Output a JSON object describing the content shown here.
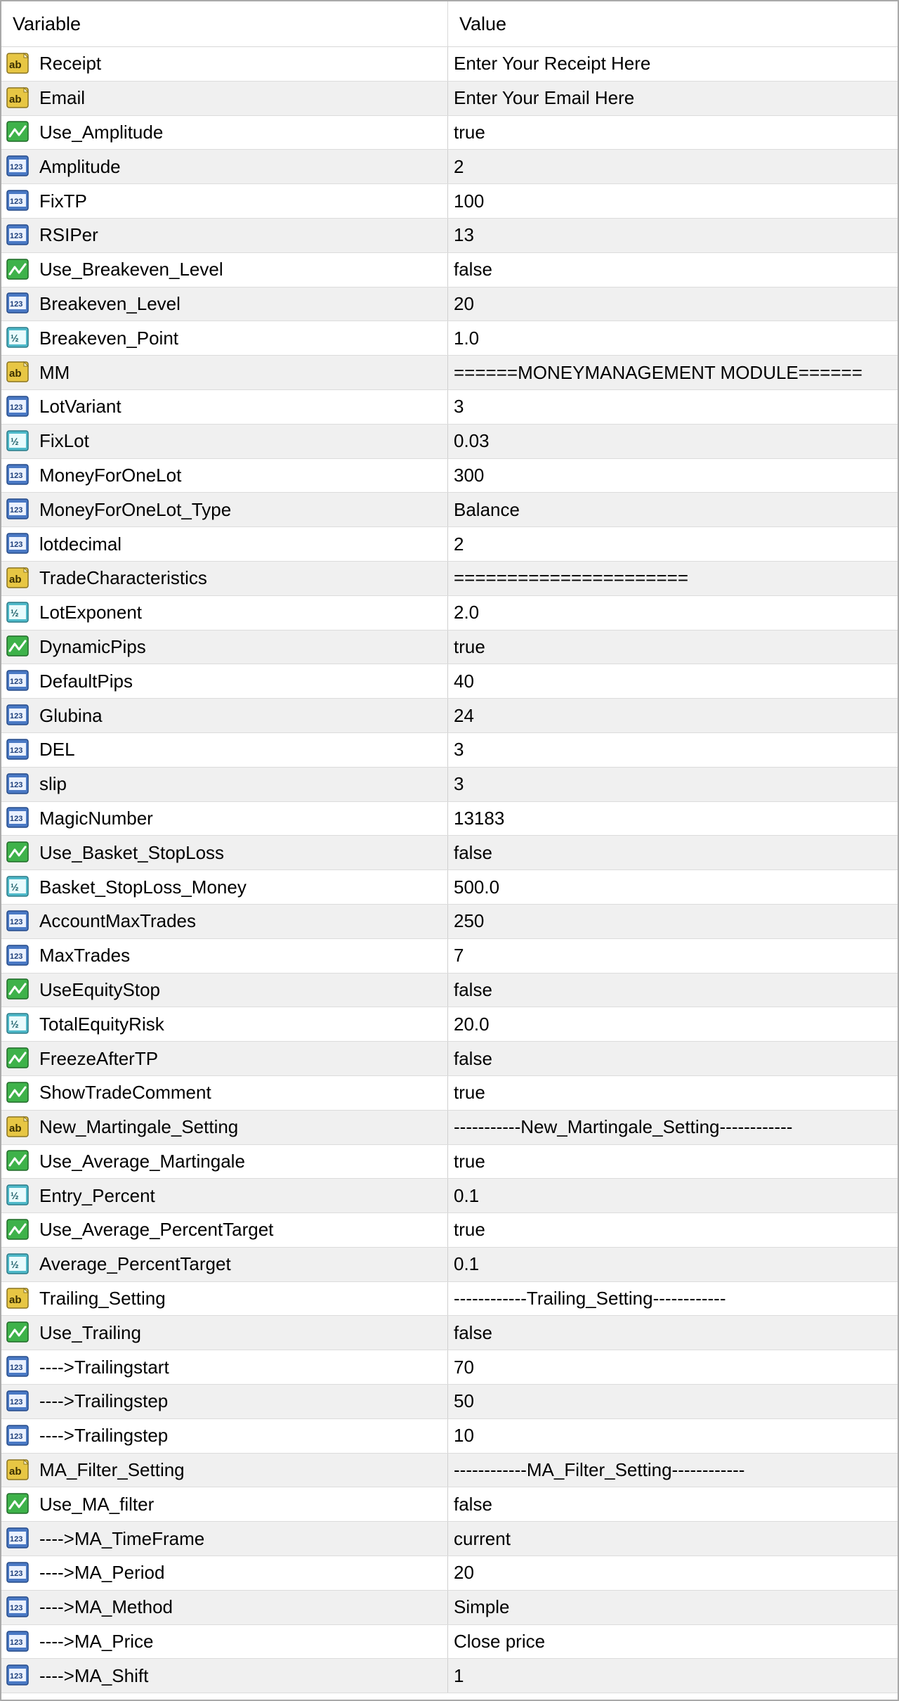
{
  "header": {
    "variable_label": "Variable",
    "value_label": "Value"
  },
  "icon_colors": {
    "string": "#e7c644",
    "bool": "#3eb24a",
    "int": "#4a79c4",
    "double": "#4fb9c9"
  },
  "rows": [
    {
      "type": "string",
      "icon": "string-icon",
      "variable": "Receipt",
      "value": "Enter Your Receipt Here"
    },
    {
      "type": "string",
      "icon": "string-icon",
      "variable": "Email",
      "value": "Enter Your Email Here"
    },
    {
      "type": "bool",
      "icon": "bool-icon",
      "variable": "Use_Amplitude",
      "value": "true"
    },
    {
      "type": "int",
      "icon": "integer-icon",
      "variable": "Amplitude",
      "value": "2"
    },
    {
      "type": "int",
      "icon": "integer-icon",
      "variable": "FixTP",
      "value": "100"
    },
    {
      "type": "int",
      "icon": "integer-icon",
      "variable": "RSIPer",
      "value": "13"
    },
    {
      "type": "bool",
      "icon": "bool-icon",
      "variable": "Use_Breakeven_Level",
      "value": "false"
    },
    {
      "type": "int",
      "icon": "integer-icon",
      "variable": "Breakeven_Level",
      "value": "20"
    },
    {
      "type": "double",
      "icon": "double-icon",
      "variable": "Breakeven_Point",
      "value": "1.0"
    },
    {
      "type": "string",
      "icon": "string-icon",
      "variable": "MM",
      "value": "======MONEYMANAGEMENT MODULE======"
    },
    {
      "type": "int",
      "icon": "integer-icon",
      "variable": "LotVariant",
      "value": "3"
    },
    {
      "type": "double",
      "icon": "double-icon",
      "variable": "FixLot",
      "value": "0.03"
    },
    {
      "type": "int",
      "icon": "integer-icon",
      "variable": "MoneyForOneLot",
      "value": "300"
    },
    {
      "type": "int",
      "icon": "integer-icon",
      "variable": "MoneyForOneLot_Type",
      "value": "Balance"
    },
    {
      "type": "int",
      "icon": "integer-icon",
      "variable": "lotdecimal",
      "value": "2"
    },
    {
      "type": "string",
      "icon": "string-icon",
      "variable": "TradeCharacteristics",
      "value": "======================"
    },
    {
      "type": "double",
      "icon": "double-icon",
      "variable": "LotExponent",
      "value": "2.0"
    },
    {
      "type": "bool",
      "icon": "bool-icon",
      "variable": "DynamicPips",
      "value": "true"
    },
    {
      "type": "int",
      "icon": "integer-icon",
      "variable": "DefaultPips",
      "value": "40"
    },
    {
      "type": "int",
      "icon": "integer-icon",
      "variable": "Glubina",
      "value": "24"
    },
    {
      "type": "int",
      "icon": "integer-icon",
      "variable": "DEL",
      "value": "3"
    },
    {
      "type": "int",
      "icon": "integer-icon",
      "variable": "slip",
      "value": "3"
    },
    {
      "type": "int",
      "icon": "integer-icon",
      "variable": "MagicNumber",
      "value": "13183"
    },
    {
      "type": "bool",
      "icon": "bool-icon",
      "variable": "Use_Basket_StopLoss",
      "value": "false"
    },
    {
      "type": "double",
      "icon": "double-icon",
      "variable": "Basket_StopLoss_Money",
      "value": "500.0"
    },
    {
      "type": "int",
      "icon": "integer-icon",
      "variable": "AccountMaxTrades",
      "value": "250"
    },
    {
      "type": "int",
      "icon": "integer-icon",
      "variable": "MaxTrades",
      "value": "7"
    },
    {
      "type": "bool",
      "icon": "bool-icon",
      "variable": "UseEquityStop",
      "value": "false"
    },
    {
      "type": "double",
      "icon": "double-icon",
      "variable": "TotalEquityRisk",
      "value": "20.0"
    },
    {
      "type": "bool",
      "icon": "bool-icon",
      "variable": "FreezeAfterTP",
      "value": "false"
    },
    {
      "type": "bool",
      "icon": "bool-icon",
      "variable": "ShowTradeComment",
      "value": "true"
    },
    {
      "type": "string",
      "icon": "string-icon",
      "variable": "New_Martingale_Setting",
      "value": "-----------New_Martingale_Setting------------"
    },
    {
      "type": "bool",
      "icon": "bool-icon",
      "variable": "Use_Average_Martingale",
      "value": "true"
    },
    {
      "type": "double",
      "icon": "double-icon",
      "variable": "Entry_Percent",
      "value": "0.1"
    },
    {
      "type": "bool",
      "icon": "bool-icon",
      "variable": "Use_Average_PercentTarget",
      "value": "true"
    },
    {
      "type": "double",
      "icon": "double-icon",
      "variable": "Average_PercentTarget",
      "value": "0.1"
    },
    {
      "type": "string",
      "icon": "string-icon",
      "variable": "Trailing_Setting",
      "value": "------------Trailing_Setting------------"
    },
    {
      "type": "bool",
      "icon": "bool-icon",
      "variable": "Use_Trailing",
      "value": "false"
    },
    {
      "type": "int",
      "icon": "integer-icon",
      "variable": "---->Trailingstart",
      "value": "70"
    },
    {
      "type": "int",
      "icon": "integer-icon",
      "variable": "---->Trailingstep",
      "value": "50"
    },
    {
      "type": "int",
      "icon": "integer-icon",
      "variable": "---->Trailingstep",
      "value": "10"
    },
    {
      "type": "string",
      "icon": "string-icon",
      "variable": "MA_Filter_Setting",
      "value": "------------MA_Filter_Setting------------"
    },
    {
      "type": "bool",
      "icon": "bool-icon",
      "variable": "Use_MA_filter",
      "value": "false"
    },
    {
      "type": "int",
      "icon": "integer-icon",
      "variable": "---->MA_TimeFrame",
      "value": "current"
    },
    {
      "type": "int",
      "icon": "integer-icon",
      "variable": "---->MA_Period",
      "value": "20"
    },
    {
      "type": "int",
      "icon": "integer-icon",
      "variable": "---->MA_Method",
      "value": "Simple"
    },
    {
      "type": "int",
      "icon": "integer-icon",
      "variable": "---->MA_Price",
      "value": "Close price"
    },
    {
      "type": "int",
      "icon": "integer-icon",
      "variable": "---->MA_Shift",
      "value": "1"
    }
  ]
}
